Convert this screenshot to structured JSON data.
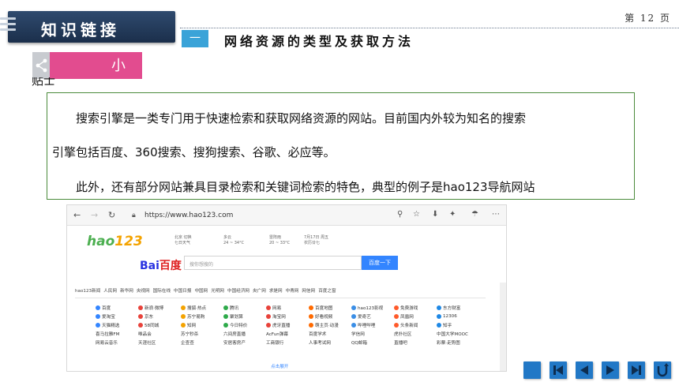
{
  "header": {
    "title": "知识链接",
    "page": "第 12 页"
  },
  "section": {
    "number": "一",
    "title": "网络资源的类型及获取方法"
  },
  "tip": {
    "label": "小",
    "cutoff": "贴士"
  },
  "paragraphs": [
    "搜索引擎是一类专门用于快速检索和获取网络资源的网站。目前国内外较为知名的搜索",
    "引擎包括百度、360搜索、搜狗搜索、谷歌、必应等。",
    "此外，还有部分网站兼具目录检索和关键词检索的特色，典型的例子是hao123导航网站"
  ],
  "browser": {
    "url": "https://www.hao123.com",
    "logo_a": "hao",
    "logo_b": "123",
    "weather": [
      "北京 切换",
      "七日天气",
      "多云",
      "24 ~ 34°C",
      "雷阵雨",
      "20 ~ 33°C",
      "7月17日 周五",
      "农历廿七"
    ],
    "baidu_a": "Bai",
    "baidu_b": "百度",
    "search_placeholder": "搜你想搜的",
    "search_button": "百度一下",
    "tabs": [
      "hao123新闻",
      "人民网",
      "新华网",
      "央视网",
      "国际在线",
      "中国日报",
      "中国网",
      "光明网",
      "中国经济网",
      "央广网",
      "求是网",
      "中青网",
      "网信网",
      "百度之窗"
    ],
    "sites": [
      [
        "百度",
        "新浪·微博",
        "搜狐·热点",
        "腾讯",
        "网易",
        "百度地图",
        "hao123影视",
        "免费游戏",
        "东方财富"
      ],
      [
        "爱淘宝",
        "京东",
        "苏宁易购",
        "聚划算",
        "淘宝网",
        "好看视频",
        "爱奇艺",
        "凤凰网",
        "12306"
      ],
      [
        "天猫精选",
        "58同城",
        "知网",
        "今日特价",
        "虎牙直播",
        "萌主页·动漫",
        "哔哩哔哩",
        "头条新闻",
        "知乎"
      ],
      [
        "喜马拉雅FM",
        "唯品会",
        "苏宁秒杀",
        "六间房直播",
        "AcFun弹幕",
        "百度学术",
        "学信网",
        "虎扑社区",
        "中国大学MOOC"
      ],
      [
        "网易云音乐",
        "天涯社区",
        "企查查",
        "安居客房产",
        "工商银行",
        "人事考试网",
        "QQ邮箱",
        "直播吧",
        "彩票·走势图"
      ]
    ],
    "more": "点击展开"
  },
  "colors": {
    "accent": "#2278c6",
    "tip": "#e24c8f",
    "box_border": "#4b8b3b",
    "header": "#1b2f4b"
  }
}
